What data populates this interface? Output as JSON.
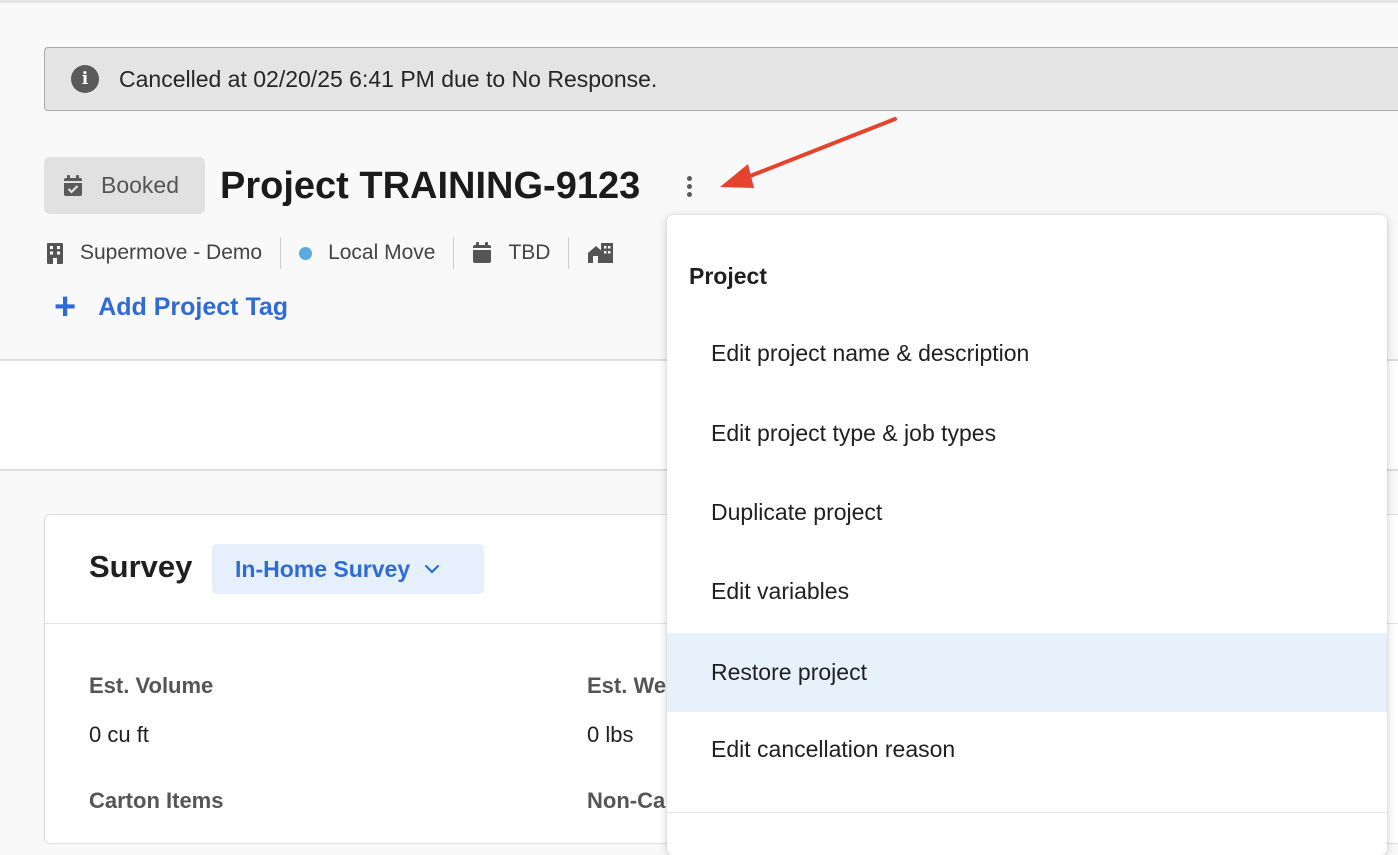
{
  "banner": {
    "text": "Cancelled at 02/20/25 6:41 PM due to No Response."
  },
  "project": {
    "status": "Booked",
    "title": "Project TRAINING-9123"
  },
  "meta": {
    "organization": "Supermove - Demo",
    "project_type": "Local Move",
    "project_type_color": "#5aa9e0",
    "date": "TBD"
  },
  "add_tag_label": "Add Project Tag",
  "survey": {
    "title": "Survey",
    "type_selected": "In-Home Survey",
    "est_volume_label": "Est. Volume",
    "est_volume_value": "0 cu ft",
    "est_weight_label": "Est. We",
    "est_weight_value": "0 lbs",
    "carton_items_label": "Carton Items",
    "non_carton_label": "Non-Ca"
  },
  "menu": {
    "heading": "Project",
    "items": [
      {
        "label": "Edit project name & description"
      },
      {
        "label": "Edit project type & job types"
      },
      {
        "label": "Duplicate project"
      },
      {
        "label": "Edit variables"
      },
      {
        "label": "Restore project"
      },
      {
        "label": "Edit cancellation reason"
      }
    ]
  },
  "colors": {
    "accent": "#2f6bd8",
    "annotation_arrow": "#e5432e",
    "menu_highlight": "#e7f1fc"
  }
}
